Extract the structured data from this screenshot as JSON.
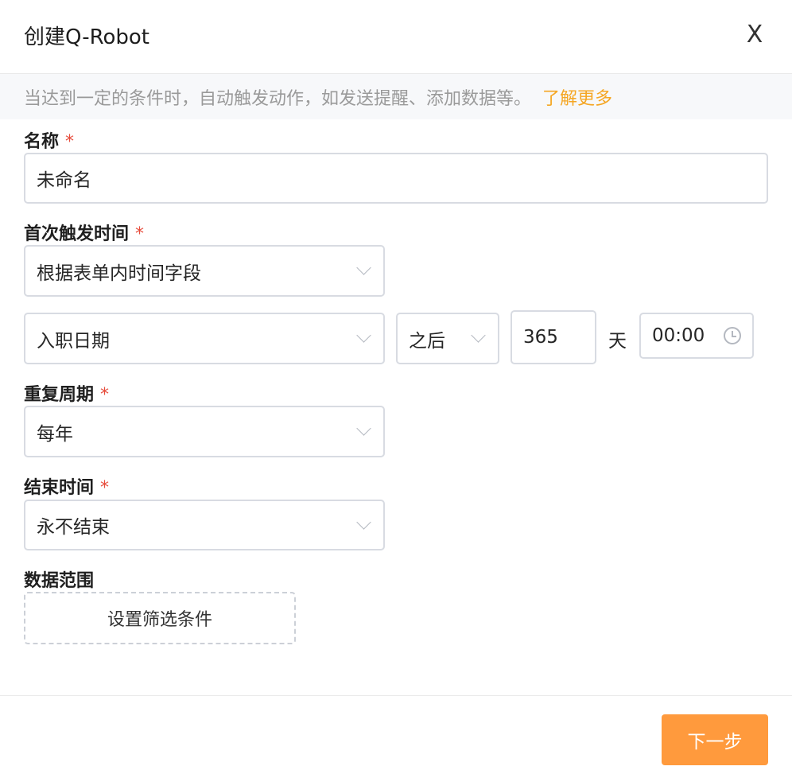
{
  "dialog": {
    "title": "创建Q-Robot",
    "close_label": "X"
  },
  "notice": {
    "text": "当达到一定的条件时，自动触发动作，如发送提醒、添加数据等。",
    "link": "了解更多"
  },
  "form": {
    "required_mark": "*",
    "name": {
      "label": "名称",
      "value": "未命名"
    },
    "first_trigger": {
      "label": "首次触发时间",
      "mode": "根据表单内时间字段",
      "field": "入职日期",
      "relation": "之后",
      "offset": "365",
      "unit": "天",
      "time": "00:00"
    },
    "repeat": {
      "label": "重复周期",
      "value": "每年"
    },
    "end_time": {
      "label": "结束时间",
      "value": "永不结束"
    },
    "data_scope": {
      "label": "数据范围",
      "filter_button": "设置筛选条件"
    }
  },
  "footer": {
    "next_button": "下一步"
  },
  "icons": {
    "close": "close-icon",
    "dropdown": "chevron-down-icon",
    "time": "clock-icon"
  },
  "colors": {
    "accent": "#ff9a3d",
    "link": "#f5a623",
    "required": "#e74c3c",
    "border": "#d8dbe2"
  }
}
